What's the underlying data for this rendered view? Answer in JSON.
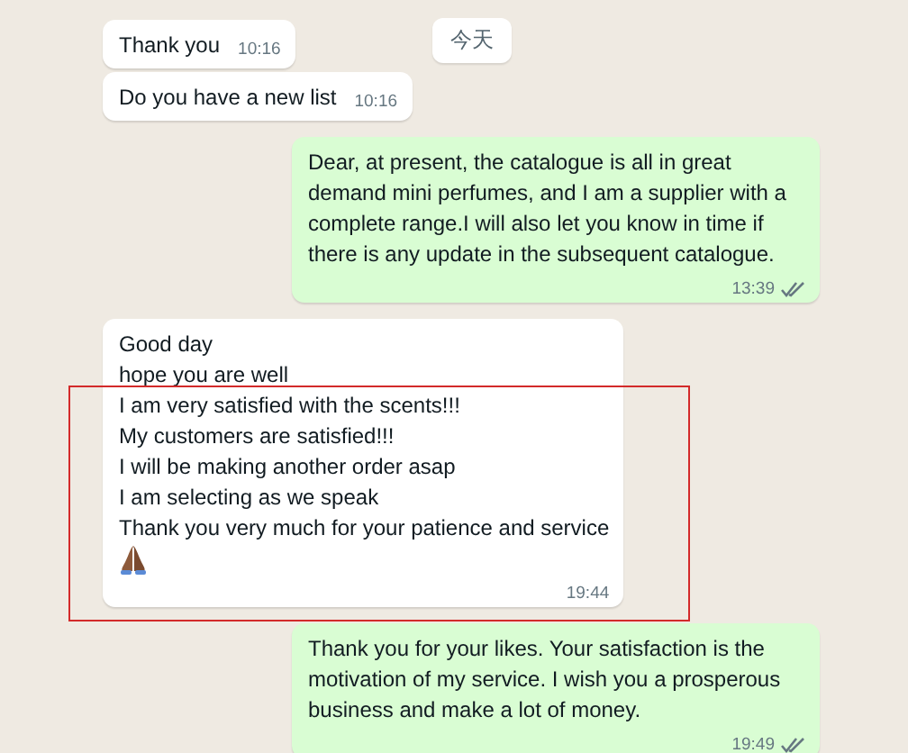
{
  "date_chip": "今天",
  "messages": [
    {
      "kind": "incoming",
      "parts": [
        {
          "text": "Thank you",
          "highlighted": false
        }
      ],
      "time": "10:16"
    },
    {
      "kind": "incoming",
      "parts": [
        {
          "text": "Do you have a new list",
          "highlighted": false
        }
      ],
      "time": "10:16"
    },
    {
      "kind": "outgoing",
      "parts": [
        {
          "text": "Dear, at present, the catalogue is all in great demand mini perfumes, and I am a supplier with a complete range.I will also let you know in time if there is any update in the subsequent catalogue.",
          "highlighted": false
        }
      ],
      "time": "13:39",
      "read": true
    },
    {
      "kind": "incoming",
      "parts": [
        {
          "text": "Good day\nhope you are well",
          "highlighted": false
        },
        {
          "text": "I am very satisfied with the scents!!!\nMy customers are satisfied!!!\nI will be making another order asap\nI am selecting as we speak\nThank you very much for your patience and service",
          "highlighted": true
        }
      ],
      "time": "19:44",
      "emoji": true
    },
    {
      "kind": "outgoing",
      "parts": [
        {
          "text": "Thank you for your likes. Your satisfaction is the motivation of my service. I wish you a prosperous business and make a lot of money.",
          "highlighted": false
        }
      ],
      "time": "19:49",
      "read": true
    }
  ]
}
